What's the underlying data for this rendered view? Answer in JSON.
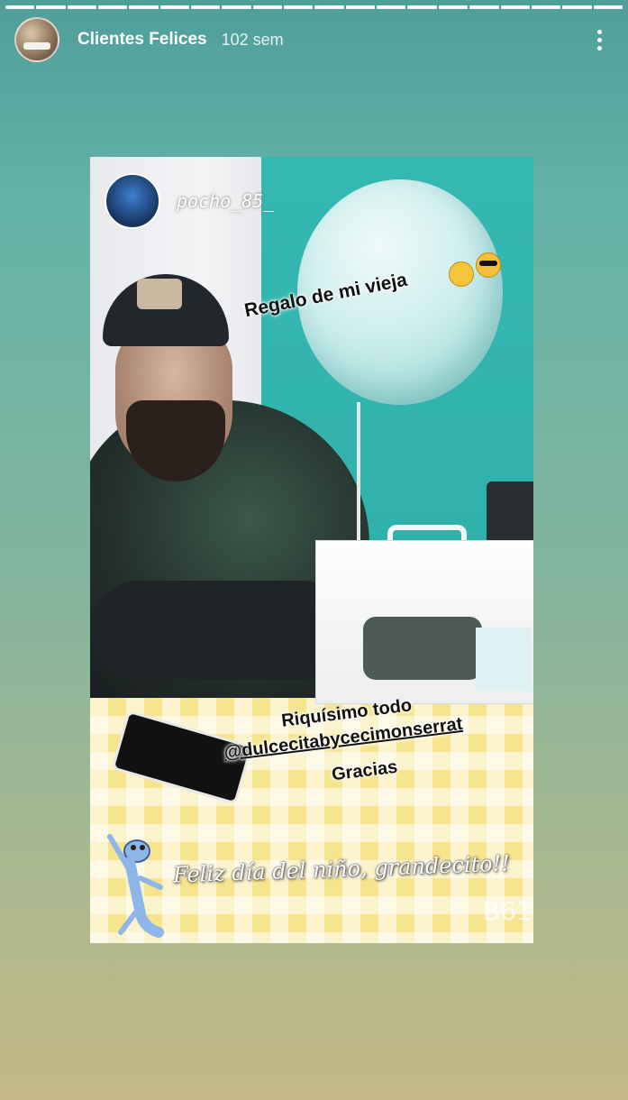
{
  "progress": {
    "segments": 20
  },
  "header": {
    "username": "Clientes Felices",
    "time": "102 sem",
    "menu_icon": "more-vertical-icon"
  },
  "story": {
    "poster_username": "pocho_85_",
    "caption_top": "Regalo de mi vieja",
    "caption_line1": "Riquísimo todo",
    "caption_handle": "@dulcecitabycecimonserrat",
    "caption_line3": "Gracias",
    "handwritten": "Feliz día del niño, grandecito!!",
    "watermark": "B612"
  },
  "colors": {
    "background_top": "#4f9e9a",
    "background_bottom": "#c4b888",
    "text": "#ffffff"
  }
}
